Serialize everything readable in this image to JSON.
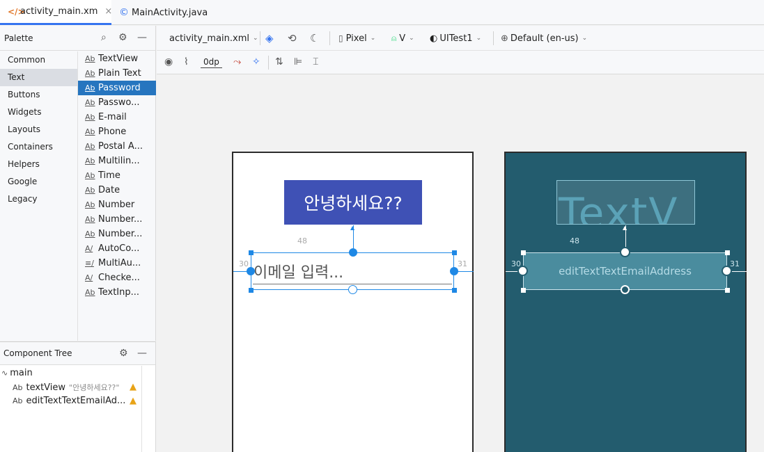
{
  "tabs": [
    {
      "label": "activity_main.xm",
      "icon": "xml-icon",
      "close": "×"
    },
    {
      "label": "MainActivity.java",
      "icon": "java-class-icon"
    }
  ],
  "palette": {
    "title": "Palette",
    "categories": [
      "Common",
      "Text",
      "Buttons",
      "Widgets",
      "Layouts",
      "Containers",
      "Helpers",
      "Google",
      "Legacy"
    ],
    "selected_category": "Text",
    "items": [
      {
        "icon": "Ab",
        "label": "TextView"
      },
      {
        "icon": "Ab",
        "label": "Plain Text"
      },
      {
        "icon": "Ab",
        "label": "Password"
      },
      {
        "icon": "Ab",
        "label": "Passwo..."
      },
      {
        "icon": "Ab",
        "label": "E-mail"
      },
      {
        "icon": "Ab",
        "label": "Phone"
      },
      {
        "icon": "Ab",
        "label": "Postal A..."
      },
      {
        "icon": "Ab",
        "label": "Multilin..."
      },
      {
        "icon": "Ab",
        "label": "Time"
      },
      {
        "icon": "Ab",
        "label": "Date"
      },
      {
        "icon": "Ab",
        "label": "Number"
      },
      {
        "icon": "Ab",
        "label": "Number..."
      },
      {
        "icon": "Ab",
        "label": "Number..."
      },
      {
        "icon": "A/",
        "label": "AutoCo..."
      },
      {
        "icon": "≡/",
        "label": "MultiAu..."
      },
      {
        "icon": "A/",
        "label": "Checke..."
      },
      {
        "icon": "Ab",
        "label": "TextInp..."
      }
    ],
    "selected_item": "Password"
  },
  "component_tree": {
    "title": "Component Tree",
    "root": "main",
    "children": [
      {
        "icon": "Ab",
        "label": "textView",
        "detail": "\"안녕하세요??\""
      },
      {
        "icon": "Ab",
        "label": "editTextTextEmailAd...",
        "detail": ""
      }
    ]
  },
  "toolbar": {
    "file": "activity_main.xml",
    "device": "Pixel",
    "api": "V",
    "theme": "UITest1",
    "locale": "Default (en-us)",
    "default_margin": "0dp"
  },
  "design": {
    "textview_text": "안녕하세요??",
    "edittext_hint": "이메일 입력...",
    "margin_top": "48",
    "margin_left": "30",
    "margin_right": "31"
  },
  "blueprint": {
    "textview_text": "TextV",
    "edittext_id": "editTextTextEmailAddress",
    "margin_top": "48",
    "margin_left": "30",
    "margin_right": "31"
  },
  "colors": {
    "accent": "#3574f0",
    "selection": "#2675bf",
    "textview_bg": "#3f51b5",
    "blueprint_bg": "#235c6e",
    "warning": "#e8a317"
  }
}
